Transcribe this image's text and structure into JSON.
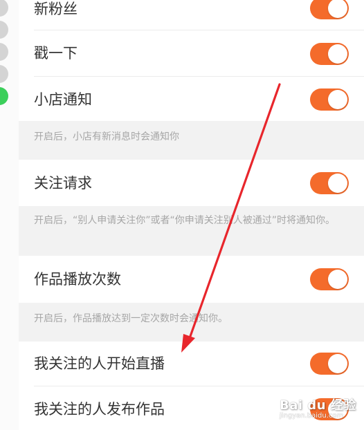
{
  "colors": {
    "accent": "#f46b2b",
    "background": "#f2f2f2",
    "row_background": "#ffffff",
    "text": "#333333",
    "description_text": "#a6a6a6",
    "annotation_arrow": "#e8262c"
  },
  "settings": [
    {
      "label": "新粉丝",
      "enabled": true
    },
    {
      "label": "戳一下",
      "enabled": true
    },
    {
      "label": "小店通知",
      "enabled": true,
      "description": "开启后，小店有新消息时会通知你"
    },
    {
      "label": "关注请求",
      "enabled": true,
      "description": "开启后，“别人申请关注你”或者“你申请关注别人被通过”时将通知你。"
    },
    {
      "label": "作品播放次数",
      "enabled": true,
      "description": "开启后，作品播放达到一定次数时会通知你。"
    },
    {
      "label": "我关注的人开始直播",
      "enabled": true
    },
    {
      "label": "我关注的人发布作品",
      "enabled": true
    }
  ],
  "watermark": {
    "logo_text": "Bai du 经验",
    "url_text": "jingyan.baidu.com"
  }
}
